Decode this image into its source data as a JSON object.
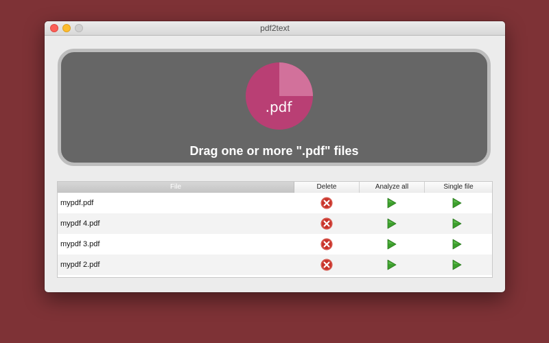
{
  "window": {
    "title": "pdf2text"
  },
  "dropzone": {
    "label": "Drag one or more \".pdf\" files",
    "icon_text": ".pdf"
  },
  "table": {
    "columns": [
      "File",
      "Delete",
      "Analyze all",
      "Single file"
    ],
    "rows": [
      {
        "file": "mypdf.pdf"
      },
      {
        "file": "mypdf 4.pdf"
      },
      {
        "file": "mypdf 3.pdf"
      },
      {
        "file": "mypdf 2.pdf"
      }
    ]
  },
  "icons": {
    "delete": "delete-x-icon",
    "play": "play-icon"
  },
  "colors": {
    "background": "#7e3236",
    "dropzone": "#666666",
    "pdf_icon": "#b93f74",
    "delete": "#c8342b",
    "play": "#3c9e2c"
  }
}
